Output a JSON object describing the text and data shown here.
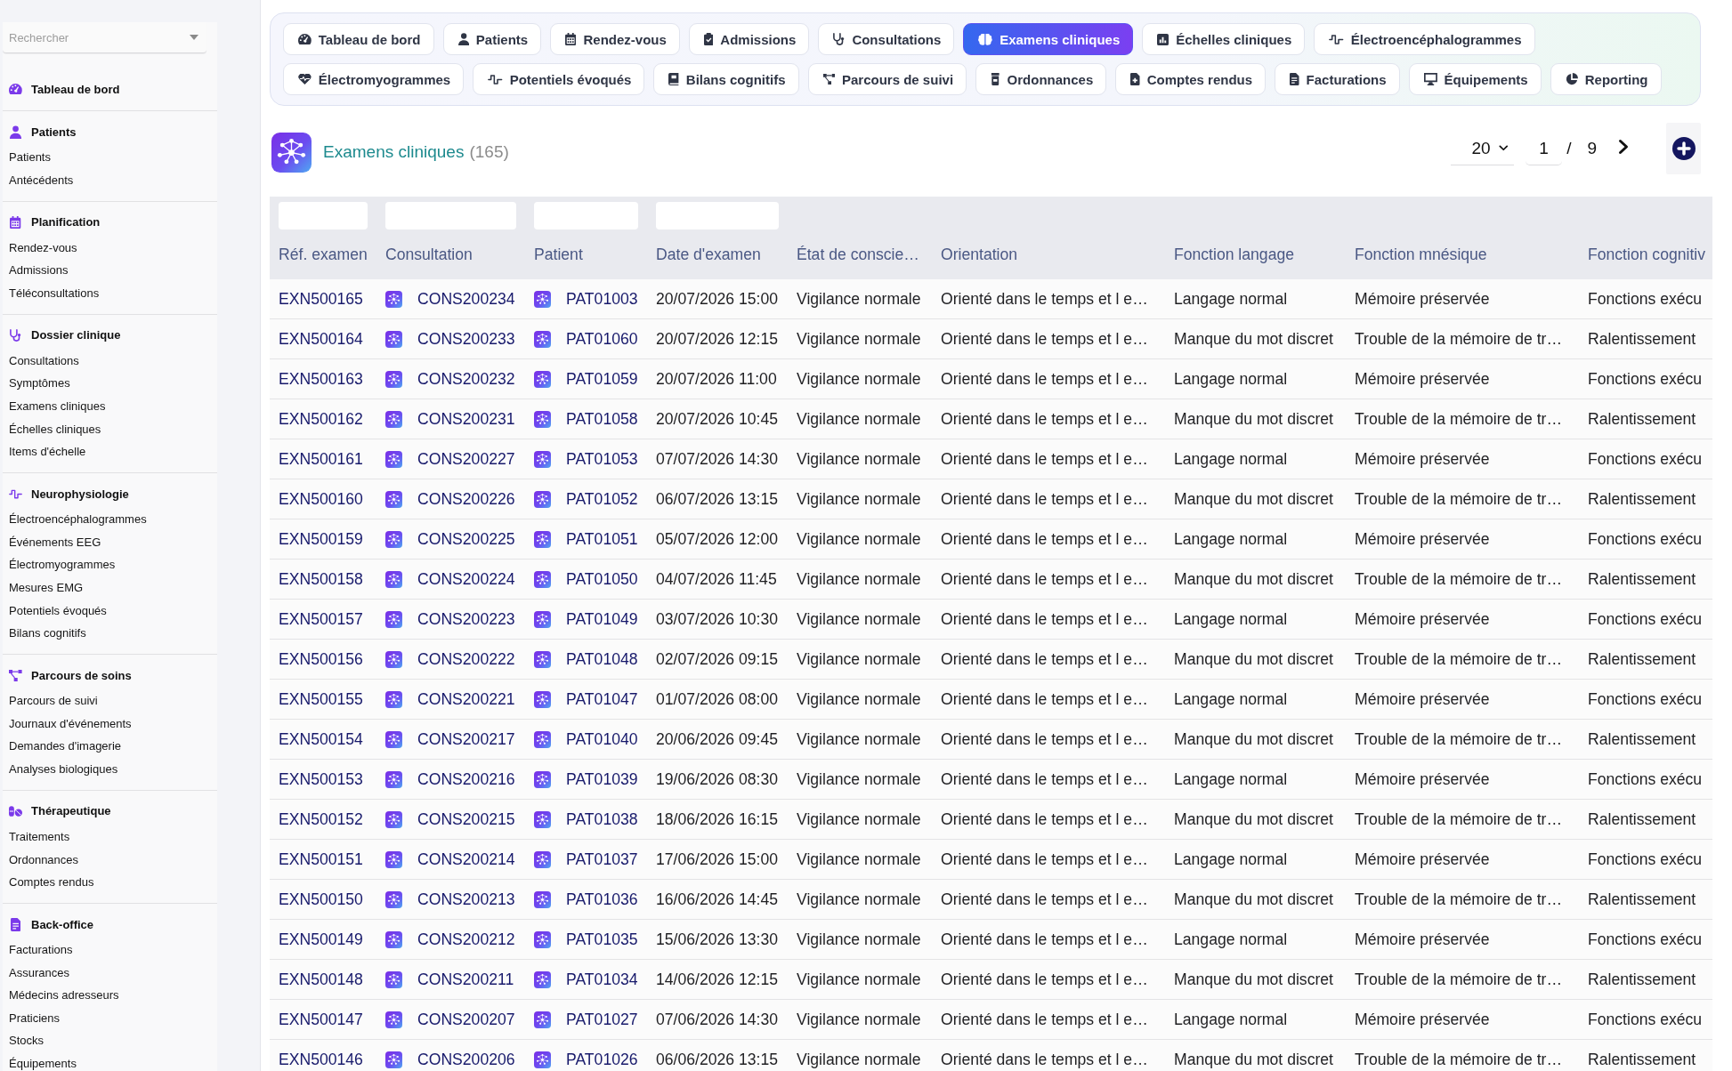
{
  "sidebar": {
    "search": {
      "placeholder": "Rechercher"
    },
    "sections": [
      {
        "title": "Tableau de bord"
      },
      {
        "title": "Patients",
        "items": [
          "Patients",
          "Antécédents"
        ]
      },
      {
        "title": "Planification",
        "items": [
          "Rendez-vous",
          "Admissions",
          "Téléconsultations"
        ]
      },
      {
        "title": "Dossier clinique",
        "items": [
          "Consultations",
          "Symptômes",
          "Examens cliniques",
          "Échelles cliniques",
          "Items d'échelle"
        ]
      },
      {
        "title": "Neurophysiologie",
        "items": [
          "Électroencéphalogrammes",
          "Événements EEG",
          "Électromyogrammes",
          "Mesures EMG",
          "Potentiels évoqués",
          "Bilans cognitifs"
        ]
      },
      {
        "title": "Parcours de soins",
        "items": [
          "Parcours de suivi",
          "Journaux d'événements",
          "Demandes d'imagerie",
          "Analyses biologiques"
        ]
      },
      {
        "title": "Thérapeutique",
        "items": [
          "Traitements",
          "Ordonnances",
          "Comptes rendus"
        ]
      },
      {
        "title": "Back-office",
        "items": [
          "Facturations",
          "Assurances",
          "Médecins adresseurs",
          "Praticiens",
          "Stocks",
          "Équipements"
        ]
      }
    ]
  },
  "tabs": [
    {
      "label": "Tableau de bord",
      "selected": false
    },
    {
      "label": "Patients",
      "selected": false
    },
    {
      "label": "Rendez-vous",
      "selected": false
    },
    {
      "label": "Admissions",
      "selected": false
    },
    {
      "label": "Consultations",
      "selected": false
    },
    {
      "label": "Examens cliniques",
      "selected": true
    },
    {
      "label": "Échelles cliniques",
      "selected": false
    },
    {
      "label": "Électroencéphalogrammes",
      "selected": false
    },
    {
      "label": "Électromyogrammes",
      "selected": false
    },
    {
      "label": "Potentiels évoqués",
      "selected": false
    },
    {
      "label": "Bilans cognitifs",
      "selected": false
    },
    {
      "label": "Parcours de suivi",
      "selected": false
    },
    {
      "label": "Ordonnances",
      "selected": false
    },
    {
      "label": "Comptes rendus",
      "selected": false
    },
    {
      "label": "Facturations",
      "selected": false
    },
    {
      "label": "Équipements",
      "selected": false
    },
    {
      "label": "Reporting",
      "selected": false
    }
  ],
  "page_header": {
    "title": "Examens cliniques",
    "count": "(165)"
  },
  "pagination": {
    "page_size": "20",
    "page": "1",
    "separator": "/",
    "total_pages": "9"
  },
  "table": {
    "columns": [
      {
        "label": "Réf. examen",
        "kind": "link",
        "filterable": true
      },
      {
        "label": "Consultation",
        "kind": "link_icon",
        "filterable": true
      },
      {
        "label": "Patient",
        "kind": "link_icon",
        "filterable": true
      },
      {
        "label": "Date d'examen",
        "kind": "text",
        "filterable": true
      },
      {
        "label": "État de conscie…",
        "kind": "text",
        "filterable": false
      },
      {
        "label": "Orientation",
        "kind": "text",
        "filterable": false
      },
      {
        "label": "Fonction langage",
        "kind": "text",
        "filterable": false
      },
      {
        "label": "Fonction mnésique",
        "kind": "text",
        "filterable": false
      },
      {
        "label": "Fonction cognitiv",
        "kind": "text",
        "filterable": false
      }
    ],
    "rows": [
      {
        "cells": [
          "EXN500165",
          "CONS200234",
          "PAT01003",
          "20/07/2026 15:00",
          "Vigilance normale",
          "Orienté dans le temps et l e…",
          "Langage normal",
          "Mémoire préservée",
          "Fonctions exécu"
        ]
      },
      {
        "cells": [
          "EXN500164",
          "CONS200233",
          "PAT01060",
          "20/07/2026 12:15",
          "Vigilance normale",
          "Orienté dans le temps et l e…",
          "Manque du mot discret",
          "Trouble de la mémoire de tr…",
          "Ralentissement"
        ]
      },
      {
        "cells": [
          "EXN500163",
          "CONS200232",
          "PAT01059",
          "20/07/2026 11:00",
          "Vigilance normale",
          "Orienté dans le temps et l e…",
          "Langage normal",
          "Mémoire préservée",
          "Fonctions exécu"
        ]
      },
      {
        "cells": [
          "EXN500162",
          "CONS200231",
          "PAT01058",
          "20/07/2026 10:45",
          "Vigilance normale",
          "Orienté dans le temps et l e…",
          "Manque du mot discret",
          "Trouble de la mémoire de tr…",
          "Ralentissement"
        ]
      },
      {
        "cells": [
          "EXN500161",
          "CONS200227",
          "PAT01053",
          "07/07/2026 14:30",
          "Vigilance normale",
          "Orienté dans le temps et l e…",
          "Langage normal",
          "Mémoire préservée",
          "Fonctions exécu"
        ]
      },
      {
        "cells": [
          "EXN500160",
          "CONS200226",
          "PAT01052",
          "06/07/2026 13:15",
          "Vigilance normale",
          "Orienté dans le temps et l e…",
          "Manque du mot discret",
          "Trouble de la mémoire de tr…",
          "Ralentissement"
        ]
      },
      {
        "cells": [
          "EXN500159",
          "CONS200225",
          "PAT01051",
          "05/07/2026 12:00",
          "Vigilance normale",
          "Orienté dans le temps et l e…",
          "Langage normal",
          "Mémoire préservée",
          "Fonctions exécu"
        ]
      },
      {
        "cells": [
          "EXN500158",
          "CONS200224",
          "PAT01050",
          "04/07/2026 11:45",
          "Vigilance normale",
          "Orienté dans le temps et l e…",
          "Manque du mot discret",
          "Trouble de la mémoire de tr…",
          "Ralentissement"
        ]
      },
      {
        "cells": [
          "EXN500157",
          "CONS200223",
          "PAT01049",
          "03/07/2026 10:30",
          "Vigilance normale",
          "Orienté dans le temps et l e…",
          "Langage normal",
          "Mémoire préservée",
          "Fonctions exécu"
        ]
      },
      {
        "cells": [
          "EXN500156",
          "CONS200222",
          "PAT01048",
          "02/07/2026 09:15",
          "Vigilance normale",
          "Orienté dans le temps et l e…",
          "Manque du mot discret",
          "Trouble de la mémoire de tr…",
          "Ralentissement"
        ]
      },
      {
        "cells": [
          "EXN500155",
          "CONS200221",
          "PAT01047",
          "01/07/2026 08:00",
          "Vigilance normale",
          "Orienté dans le temps et l e…",
          "Langage normal",
          "Mémoire préservée",
          "Fonctions exécu"
        ]
      },
      {
        "cells": [
          "EXN500154",
          "CONS200217",
          "PAT01040",
          "20/06/2026 09:45",
          "Vigilance normale",
          "Orienté dans le temps et l e…",
          "Manque du mot discret",
          "Trouble de la mémoire de tr…",
          "Ralentissement"
        ]
      },
      {
        "cells": [
          "EXN500153",
          "CONS200216",
          "PAT01039",
          "19/06/2026 08:30",
          "Vigilance normale",
          "Orienté dans le temps et l e…",
          "Langage normal",
          "Mémoire préservée",
          "Fonctions exécu"
        ]
      },
      {
        "cells": [
          "EXN500152",
          "CONS200215",
          "PAT01038",
          "18/06/2026 16:15",
          "Vigilance normale",
          "Orienté dans le temps et l e…",
          "Manque du mot discret",
          "Trouble de la mémoire de tr…",
          "Ralentissement"
        ]
      },
      {
        "cells": [
          "EXN500151",
          "CONS200214",
          "PAT01037",
          "17/06/2026 15:00",
          "Vigilance normale",
          "Orienté dans le temps et l e…",
          "Langage normal",
          "Mémoire préservée",
          "Fonctions exécu"
        ]
      },
      {
        "cells": [
          "EXN500150",
          "CONS200213",
          "PAT01036",
          "16/06/2026 14:45",
          "Vigilance normale",
          "Orienté dans le temps et l e…",
          "Manque du mot discret",
          "Trouble de la mémoire de tr…",
          "Ralentissement"
        ]
      },
      {
        "cells": [
          "EXN500149",
          "CONS200212",
          "PAT01035",
          "15/06/2026 13:30",
          "Vigilance normale",
          "Orienté dans le temps et l e…",
          "Langage normal",
          "Mémoire préservée",
          "Fonctions exécu"
        ]
      },
      {
        "cells": [
          "EXN500148",
          "CONS200211",
          "PAT01034",
          "14/06/2026 12:15",
          "Vigilance normale",
          "Orienté dans le temps et l e…",
          "Manque du mot discret",
          "Trouble de la mémoire de tr…",
          "Ralentissement"
        ]
      },
      {
        "cells": [
          "EXN500147",
          "CONS200207",
          "PAT01027",
          "07/06/2026 14:30",
          "Vigilance normale",
          "Orienté dans le temps et l e…",
          "Langage normal",
          "Mémoire préservée",
          "Fonctions exécu"
        ]
      },
      {
        "cells": [
          "EXN500146",
          "CONS200206",
          "PAT01026",
          "06/06/2026 13:15",
          "Vigilance normale",
          "Orienté dans le temps et l e…",
          "Manque du mot discret",
          "Trouble de la mémoire de tr…",
          "Ralentissement"
        ]
      }
    ]
  }
}
